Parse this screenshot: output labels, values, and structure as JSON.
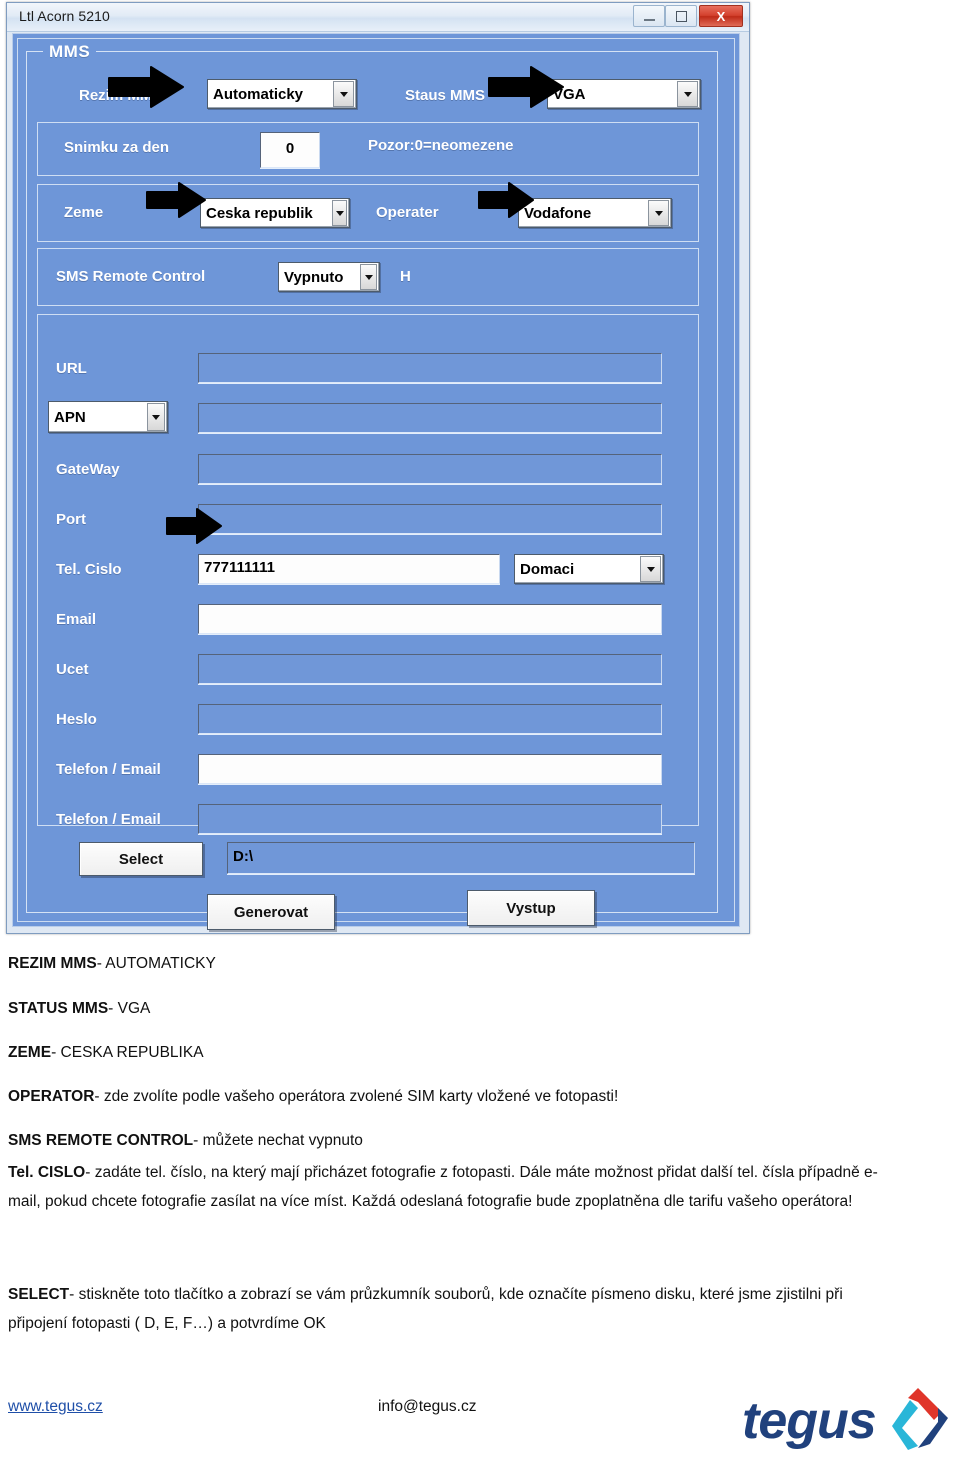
{
  "window": {
    "title": "Ltl Acorn 5210",
    "controls": {
      "minimize": "minimize-icon",
      "maximize": "maximize-icon",
      "close": "X"
    }
  },
  "form": {
    "group_legend": "MMS",
    "rows": {
      "rezim_mms": {
        "label": "Rezim MMS",
        "value": "Automaticky"
      },
      "staus_mms": {
        "label": "Staus MMS",
        "value": "VGA"
      },
      "snimku_za_den": {
        "label": "Snimku za den",
        "value": "0",
        "hint": "Pozor:0=neomezene"
      },
      "zeme": {
        "label": "Zeme",
        "value": "Ceska republik"
      },
      "operater": {
        "label": "Operater",
        "value": "Vodafone"
      },
      "sms_remote_control": {
        "label": "SMS Remote Control",
        "value": "Vypnuto",
        "unit": "H"
      },
      "url": {
        "label": "URL",
        "value": ""
      },
      "apn": {
        "label": "APN",
        "value": ""
      },
      "gateway": {
        "label": "GateWay",
        "value": ""
      },
      "port": {
        "label": "Port",
        "value": ""
      },
      "tel_cislo": {
        "label": "Tel. Cislo",
        "value": "777111111",
        "mode": "Domaci"
      },
      "email": {
        "label": "Email",
        "value": ""
      },
      "ucet": {
        "label": "Ucet",
        "value": ""
      },
      "heslo": {
        "label": "Heslo",
        "value": ""
      },
      "telefon_email_1": {
        "label": "Telefon / Email",
        "value": ""
      },
      "telefon_email_2": {
        "label": "Telefon / Email",
        "value": ""
      }
    },
    "buttons": {
      "select": "Select",
      "generovat": "Generovat",
      "vystup": "Vystup"
    },
    "path_value": "D:\\"
  },
  "doc": {
    "l1_bold": "REZIM MMS",
    "l1_rest": "- AUTOMATICKY",
    "l2_bold": "STATUS MMS",
    "l2_rest": "- VGA",
    "l3_bold": "ZEME",
    "l3_rest": "- CESKA REPUBLIKA",
    "l4_bold": "OPERATOR",
    "l4_rest": "- zde zvolíte podle vašeho operátora zvolené SIM karty vložené ve fotopasti!",
    "l5_bold": "SMS REMOTE CONTROL",
    "l5_rest": "- můžete nechat vypnuto",
    "p1_bold": "Tel. CISLO",
    "p1_rest": "- zadáte tel. číslo, na který mají přicházet fotografie z fotopasti. Dále máte možnost přidat další tel. čísla případně e-mail, pokud chcete fotografie zasílat na více míst. Každá odeslaná fotografie bude zpoplatněna dle tarifu vašeho operátora!",
    "p2_bold": "SELECT",
    "p2_rest": "- stiskněte toto tlačítko a zobrazí se vám průzkumník souborů, kde označíte písmeno disku, které jsme zjistilni při připojení fotopasti ( D, E, F…) a potvrdíme OK"
  },
  "footer": {
    "website": "www.tegus.cz",
    "email": "info@tegus.cz",
    "logo_text": "tegus"
  },
  "colors": {
    "window_blue": "#6e96d8",
    "link_blue": "#1f4fa8",
    "close_red": "#d3402c",
    "logo_navy": "#20417d",
    "logo_red": "#e0352a",
    "logo_cyan": "#29b6d8"
  }
}
